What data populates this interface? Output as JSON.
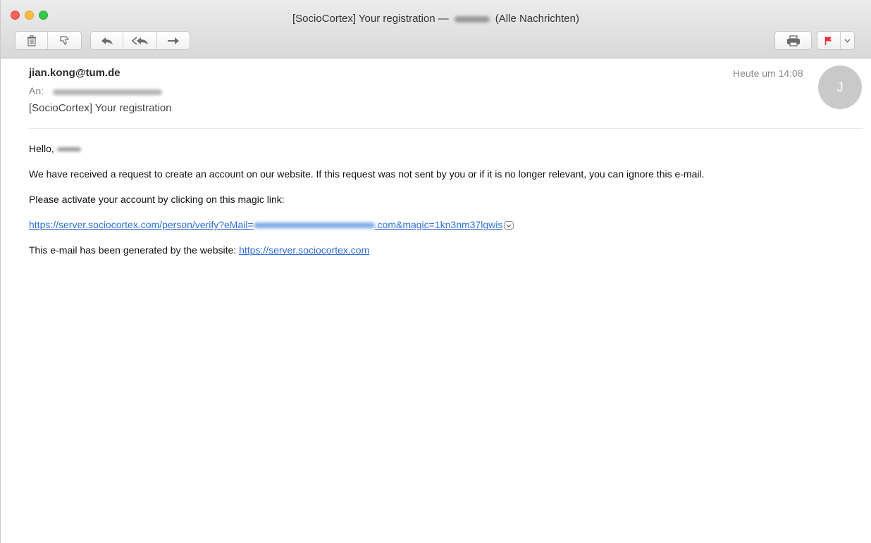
{
  "window": {
    "title_prefix": "[SocioCortex] Your registration —",
    "title_suffix": "(Alle Nachrichten)"
  },
  "toolbar": {
    "icons": [
      "trash-icon",
      "junk-icon",
      "reply-icon",
      "reply-all-icon",
      "forward-icon",
      "print-icon",
      "flag-icon",
      "chevron-down-icon"
    ],
    "flag_color": "#e8323c"
  },
  "message": {
    "from": "jian.kong@tum.de",
    "to_label": "An:",
    "subject": "[SocioCortex] Your registration",
    "date": "Heute um 14:08",
    "avatar_initial": "J"
  },
  "body": {
    "greeting": "Hello,",
    "p1": "We have received a request to create an account on our website. If this request was not sent by you or if it is no longer relevant, you can ignore this e-mail.",
    "p2": "Please activate your account by clicking on this magic link:",
    "link_prefix": "https://server.sociocortex.com/person/verify?eMail=",
    "link_suffix": ".com&magic=1kn3nm37lgwis",
    "p3_text": "This e-mail has been generated by the website:",
    "p3_link": "https://server.sociocortex.com"
  },
  "colors": {
    "link": "#2e6fd6",
    "avatar_bg": "#c9c9c9"
  }
}
